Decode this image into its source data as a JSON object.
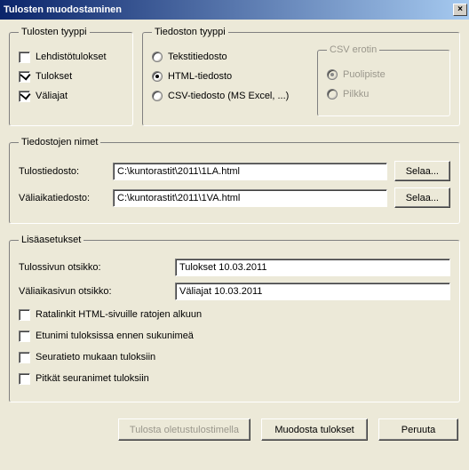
{
  "title": "Tulosten muodostaminen",
  "close_glyph": "×",
  "groups": {
    "result_type": "Tulosten tyyppi",
    "file_type": "Tiedoston tyyppi",
    "csv_sep": "CSV erotin",
    "file_names": "Tiedostojen nimet",
    "extra": "Lisäasetukset"
  },
  "result_type": {
    "press": "Lehdistötulokset",
    "results": "Tulokset",
    "splits": "Väliajat"
  },
  "file_type": {
    "text": "Tekstitiedosto",
    "html": "HTML-tiedosto",
    "csv": "CSV-tiedosto (MS Excel, ...)"
  },
  "csv_sep": {
    "semicolon": "Puolipiste",
    "comma": "Pilkku"
  },
  "files": {
    "result_label": "Tulostiedosto:",
    "result_value": "C:\\kuntorastit\\2011\\1LA.html",
    "split_label": "Väliaikatiedosto:",
    "split_value": "C:\\kuntorastit\\2011\\1VA.html",
    "browse": "Selaa..."
  },
  "extra": {
    "result_title_label": "Tulossivun otsikko:",
    "result_title_value": "Tulokset 10.03.2011",
    "split_title_label": "Väliaikasivun otsikko:",
    "split_title_value": "Väliajat 10.03.2011",
    "routelinks": "Ratalinkit HTML-sivuille ratojen alkuun",
    "firstname": "Etunimi tuloksissa ennen sukunimeä",
    "clubinfo": "Seuratieto mukaan tuloksiin",
    "longclub": "Pitkät seuranimet tuloksiin"
  },
  "buttons": {
    "print_default": "Tulosta oletustulostimella",
    "generate": "Muodosta tulokset",
    "cancel": "Peruuta"
  }
}
